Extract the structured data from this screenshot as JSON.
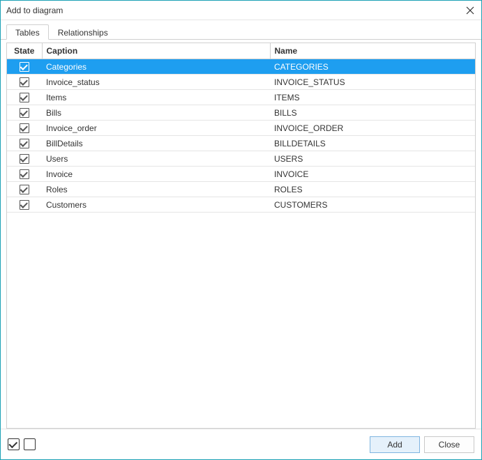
{
  "window": {
    "title": "Add to diagram"
  },
  "tabs": [
    {
      "label": "Tables",
      "active": true
    },
    {
      "label": "Relationships",
      "active": false
    }
  ],
  "columns": {
    "state": "State",
    "caption": "Caption",
    "name": "Name"
  },
  "rows": [
    {
      "checked": true,
      "selected": true,
      "caption": "Categories",
      "name": "CATEGORIES"
    },
    {
      "checked": true,
      "selected": false,
      "caption": "Invoice_status",
      "name": "INVOICE_STATUS"
    },
    {
      "checked": true,
      "selected": false,
      "caption": "Items",
      "name": "ITEMS"
    },
    {
      "checked": true,
      "selected": false,
      "caption": "Bills",
      "name": "BILLS"
    },
    {
      "checked": true,
      "selected": false,
      "caption": "Invoice_order",
      "name": "INVOICE_ORDER"
    },
    {
      "checked": true,
      "selected": false,
      "caption": "BillDetails",
      "name": "BILLDETAILS"
    },
    {
      "checked": true,
      "selected": false,
      "caption": "Users",
      "name": "USERS"
    },
    {
      "checked": true,
      "selected": false,
      "caption": "Invoice",
      "name": "INVOICE"
    },
    {
      "checked": true,
      "selected": false,
      "caption": "Roles",
      "name": "ROLES"
    },
    {
      "checked": true,
      "selected": false,
      "caption": "Customers",
      "name": "CUSTOMERS"
    }
  ],
  "footer": {
    "selectAll": {
      "checked": true
    },
    "selectNone": {
      "checked": false
    },
    "buttons": {
      "add": "Add",
      "close": "Close"
    }
  }
}
